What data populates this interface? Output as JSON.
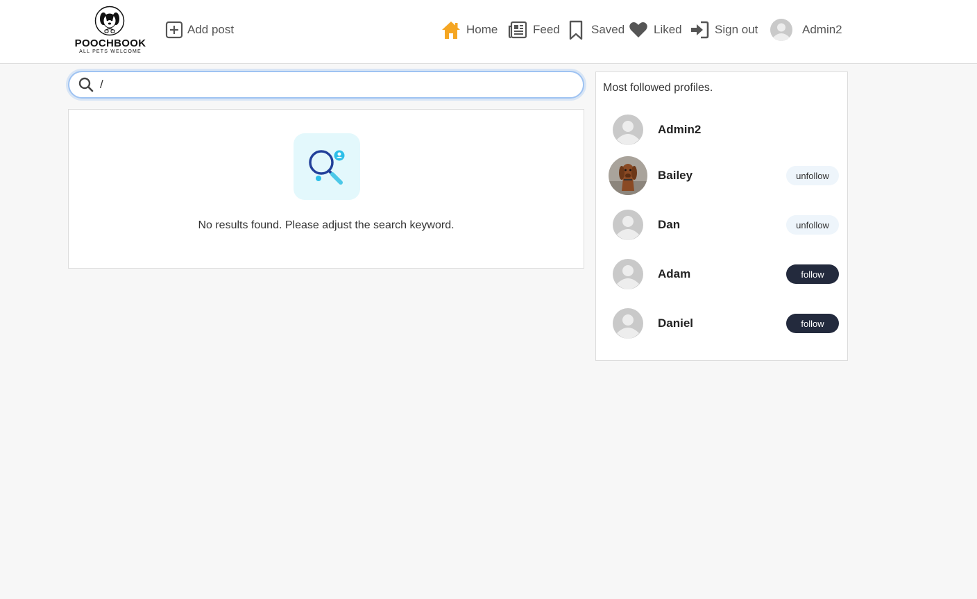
{
  "header": {
    "brand": "POOCHBOOK",
    "tagline": "ALL PETS WELCOME",
    "add_post": "Add post",
    "nav": {
      "home": "Home",
      "feed": "Feed",
      "saved": "Saved",
      "liked": "Liked",
      "sign_out": "Sign out",
      "profile": "Admin2"
    },
    "accent_color": "#f5a623"
  },
  "search": {
    "value": "/"
  },
  "results": {
    "empty_message": "No results found. Please adjust the search keyword."
  },
  "sidebar": {
    "title": "Most followed profiles.",
    "profiles": [
      {
        "name": "Admin2",
        "action": ""
      },
      {
        "name": "Bailey",
        "action": "unfollow"
      },
      {
        "name": "Dan",
        "action": "unfollow"
      },
      {
        "name": "Adam",
        "action": "follow"
      },
      {
        "name": "Daniel",
        "action": "follow"
      }
    ]
  }
}
